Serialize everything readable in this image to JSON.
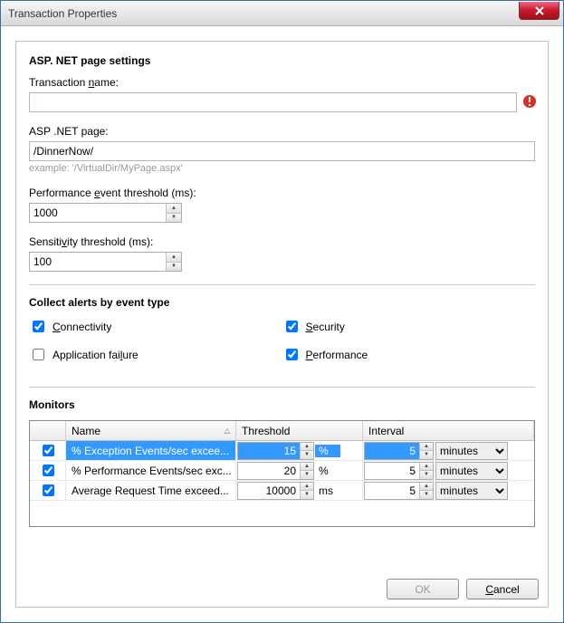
{
  "window": {
    "title": "Transaction Properties"
  },
  "sections": {
    "asp_settings": "ASP. NET page settings",
    "collect_alerts": "Collect alerts by event type",
    "monitors": "Monitors"
  },
  "labels": {
    "transaction_name_pre": "Transaction ",
    "transaction_name_u": "n",
    "transaction_name_post": "ame:",
    "asp_page_pre": "ASP .NET pa",
    "asp_page_u": "g",
    "asp_page_post": "e:",
    "perf_threshold_pre": "Performance ",
    "perf_threshold_u": "e",
    "perf_threshold_post": "vent threshold (ms):",
    "sensitivity_pre": "Sensiti",
    "sensitivity_u": "v",
    "sensitivity_post": "ity threshold (ms):",
    "example": "example: '/VirtualDir/MyPage.aspx'"
  },
  "fields": {
    "transaction_name": "",
    "asp_page": "/DinnerNow/",
    "perf_threshold": "1000",
    "sensitivity": "100"
  },
  "alerts": {
    "connectivity_u": "C",
    "connectivity_post": "onnectivity",
    "connectivity_checked": true,
    "security_u": "S",
    "security_post": "ecurity",
    "security_checked": true,
    "appfailure_pre": "Application fai",
    "appfailure_u": "l",
    "appfailure_post": "ure",
    "appfailure_checked": false,
    "performance_u": "P",
    "performance_post": "erformance",
    "performance_checked": true
  },
  "monitors_table": {
    "headers": {
      "name": "Name",
      "threshold": "Threshold",
      "interval": "Interval"
    },
    "unit_options": [
      "minutes"
    ],
    "rows": [
      {
        "checked": true,
        "name": "% Exception Events/sec excee...",
        "threshold": "15",
        "unit": "%",
        "interval": "5",
        "interval_unit": "minutes",
        "selected": true
      },
      {
        "checked": true,
        "name": "% Performance Events/sec exc...",
        "threshold": "20",
        "unit": "%",
        "interval": "5",
        "interval_unit": "minutes",
        "selected": false
      },
      {
        "checked": true,
        "name": "Average Request Time exceed...",
        "threshold": "10000",
        "unit": "ms",
        "interval": "5",
        "interval_unit": "minutes",
        "selected": false
      }
    ]
  },
  "buttons": {
    "ok": "OK",
    "cancel_u": "C",
    "cancel_post": "ancel"
  }
}
